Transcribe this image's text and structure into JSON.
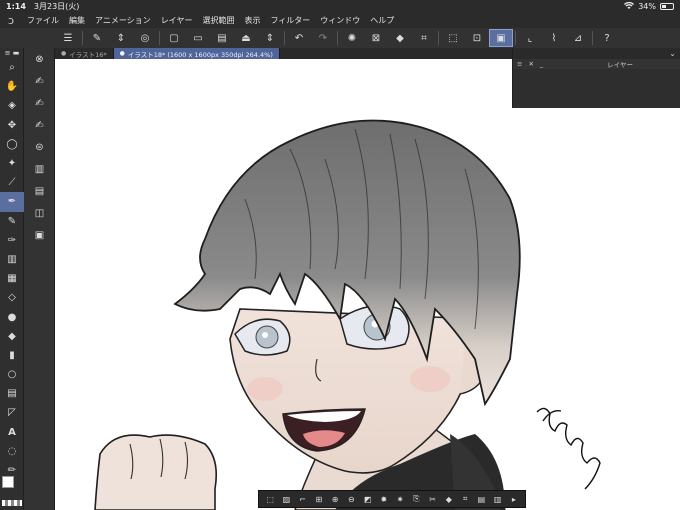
{
  "status": {
    "time": "1:14",
    "date": "3月23日(火)",
    "wifi": "wifi-icon",
    "battery": "34%"
  },
  "menu": {
    "items": [
      "ファイル",
      "編集",
      "アニメーション",
      "レイヤー",
      "選択範囲",
      "表示",
      "フィルター",
      "ウィンドウ",
      "ヘルプ"
    ]
  },
  "tabs": [
    {
      "label": "イラスト16*",
      "active": false
    },
    {
      "label": "イラスト18* (1600 x 1600px 350dpi 264.4%)",
      "active": true
    }
  ],
  "layer_panel": {
    "title": "レイヤー",
    "close_glyph": "✕",
    "minimize_glyph": "_"
  },
  "colors": {
    "accent": "#5a6fa0",
    "main_color": "#ffffff",
    "sub_color": "#1e1e1e",
    "transparent": "checker"
  }
}
